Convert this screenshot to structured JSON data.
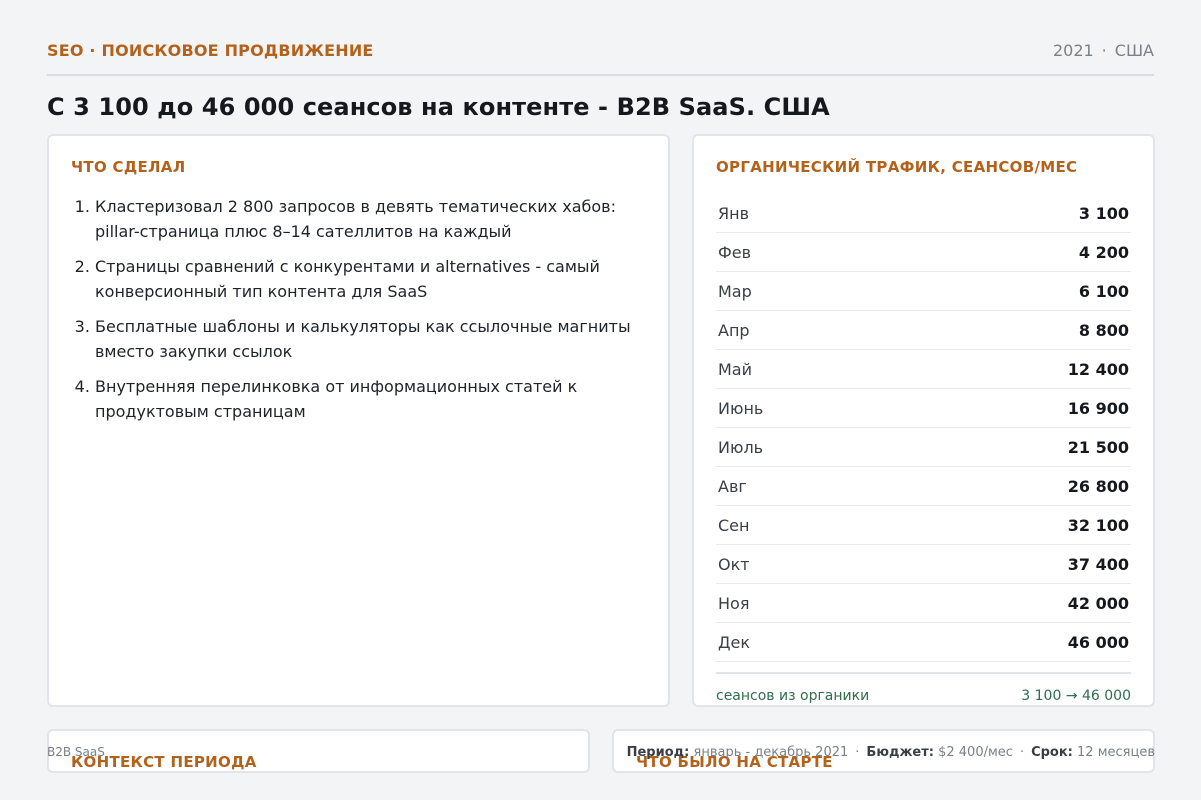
{
  "header": {
    "eyebrow": "SEO · ПОИСКОВОЕ ПРОДВИЖЕНИЕ",
    "year": "2021",
    "separator": "·",
    "country": "США",
    "title": "С 3 100 до 46 000 сеансов на контенте - B2B SaaS. США"
  },
  "left_card": {
    "heading": "ЧТО СДЕЛАЛ",
    "steps": [
      "Кластеризовал 2 800 запросов в девять тематических хабов: pillar-страница плюс 8–14 сателлитов на каждый",
      "Страницы сравнений с конкурентами и alternatives - самый конверсионный тип контента для SaaS",
      "Бесплатные шаблоны и калькуляторы как ссылочные магниты вместо закупки ссылок",
      "Внутренняя перелинковка от информационных статей к продуктовым страницам"
    ]
  },
  "right_card": {
    "heading": "ОРГАНИЧЕСКИЙ ТРАФИК, СЕАНСОВ/МЕС",
    "rows": [
      {
        "month": "Янв",
        "value": "3 100"
      },
      {
        "month": "Фев",
        "value": "4 200"
      },
      {
        "month": "Мар",
        "value": "6 100"
      },
      {
        "month": "Апр",
        "value": "8 800"
      },
      {
        "month": "Май",
        "value": "12 400"
      },
      {
        "month": "Июнь",
        "value": "16 900"
      },
      {
        "month": "Июль",
        "value": "21 500"
      },
      {
        "month": "Авг",
        "value": "26 800"
      },
      {
        "month": "Сен",
        "value": "32 100"
      },
      {
        "month": "Окт",
        "value": "37 400"
      },
      {
        "month": "Ноя",
        "value": "42 000"
      },
      {
        "month": "Дек",
        "value": "46 000"
      }
    ],
    "summary_label": "сеансов из органики",
    "summary_value": "3 100 → 46 000"
  },
  "bottom": {
    "context_heading": "КОНТЕКСТ ПЕРИОДА",
    "start_heading": "ЧТО БЫЛО НА СТАРТЕ"
  },
  "footer": {
    "client": "B2B SaaS",
    "period_label": "Период:",
    "period_value": "январь - декабрь 2021",
    "budget_label": "Бюджет:",
    "budget_value": "$2 400/мес",
    "term_label": "Срок:",
    "term_value": "12 месяцев",
    "dot": "·"
  },
  "colors": {
    "accent": "#b3621c",
    "summary_green": "#2f6d4f",
    "background": "#f3f4f6"
  }
}
